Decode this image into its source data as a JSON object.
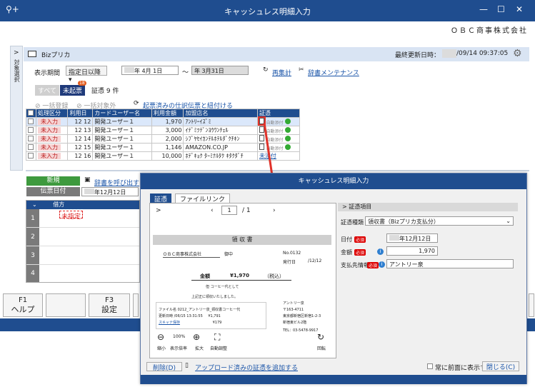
{
  "window": {
    "title": "キャッシュレス明細入力",
    "company": "ＯＢＣ商事株式会社"
  },
  "sidetab": {
    "label": "対象選択"
  },
  "header": {
    "app_name": "Bizプリカ",
    "last_updated_label": "最終更新日時：",
    "last_updated_value": "/09/14 09:37:05"
  },
  "filter": {
    "period_label": "表示期間",
    "period_mode": "指定日以降",
    "from_date": "年  4月  1日",
    "to_date": "年  3月31日",
    "refresh": "再集計",
    "maint": "辞書メンテナンス"
  },
  "tabs": {
    "all": "すべて",
    "unposted": "未起票",
    "unposted_badge": "18",
    "count": "証憑 9 件"
  },
  "actions": {
    "bulk_register": "一括登録",
    "bulk_exclude": "一括対象外",
    "link": "起票済みの仕訳伝票と紐付ける"
  },
  "table": {
    "headers": [
      "",
      "処理区分",
      "利用日",
      "カードユーザー名",
      "利用金額",
      "加盟店名",
      "証憑"
    ],
    "rows": [
      {
        "status": "未入力",
        "m": "12",
        "d": "12",
        "user": "開発ユーザー１",
        "amount": "1,970",
        "shop": "ｱﾝﾄﾘｰｲｽﾞﾐ",
        "attach": "自動添付"
      },
      {
        "status": "未入力",
        "m": "12",
        "d": "13",
        "user": "開発ユーザー１",
        "amount": "3,000",
        "shop": "ｲﾃﾞﾐﾂﾃﾞﾝﾖｳﾜﾝﾁｪﾙ",
        "attach": "自動添付"
      },
      {
        "status": "未入力",
        "m": "12",
        "d": "14",
        "user": "開発ユーザー１",
        "amount": "2,000",
        "shop": "ｼﾌﾞﾔｾｲｶﾝﾃﾙﾎﾃﾙﾀﾞｸﾁｷﾝ",
        "attach": "自動添付"
      },
      {
        "status": "未入力",
        "m": "12",
        "d": "15",
        "user": "開発ユーザー１",
        "amount": "1,146",
        "shop": "AMAZON.CO.JP",
        "attach": "自動添付"
      },
      {
        "status": "未入力",
        "m": "12",
        "d": "16",
        "user": "開発ユーザー１",
        "amount": "10,000",
        "shop": "ﾎﾃﾞｷｮｸ ﾀｰﾐﾅﾙﾀｸ ｷﾀｸﾀﾞﾁ",
        "attach": "未添付"
      }
    ]
  },
  "entry": {
    "new": "新規",
    "dict_call": "辞書を呼び出す",
    "voucher_date": "伝票日付",
    "voucher_date_value": "年12月12日",
    "credit": "借方",
    "unspecified": "未指定",
    "rows": [
      "1",
      "2",
      "3",
      "4"
    ]
  },
  "fkeys": [
    {
      "k": "F1",
      "label": "ヘルプ"
    },
    {
      "k": "",
      "label": ""
    },
    {
      "k": "F3",
      "label": "設定"
    }
  ],
  "dialog": {
    "title": "キャッシュレス明細入力",
    "tabs": [
      "証憑",
      "ファイルリンク"
    ],
    "page": "1",
    "page_total": "/ 1",
    "receipt": {
      "heading": "領 収 書",
      "company": "ＯＢＣ商事株式会社",
      "suffix": "御中",
      "no": "No.0132",
      "date": "発行日",
      "date_val": "/12/12",
      "amount_label": "金額",
      "amount": "¥1,970",
      "tax": "（税込）",
      "memo": "但  コーヒー代として",
      "received": "上記正に領収いたしました。",
      "issuer": "アントリー泉",
      "zip": "〒163-4711",
      "addr1": "東京都新宿区新宿1-2-3",
      "addr2": "新宿東ビル2階",
      "tel": "TEL：03-5478-9917",
      "file_label": "ファイル名",
      "file": "0212_アントリー泉_領収書コーヒー代",
      "upd_label": "更新日時",
      "upd": "/06/15 13:31:55",
      "scan_label": "スキャナ保存",
      "amt1": "¥1,791",
      "amt2": "¥179"
    },
    "zoom": "100%",
    "zoom_out": "縮小",
    "zoom_ratio": "表示倍率",
    "zoom_in": "拡大",
    "auto": "自動調整",
    "rotate": "回転",
    "right": {
      "section": "証憑項目",
      "type_label": "証憑種類",
      "type_value": "領収書（Bizプリカ支払分）",
      "date_label": "日付",
      "date_value": "年12月12日",
      "amount_label": "金額",
      "amount_value": "1,970",
      "payee_label": "支払先情報",
      "payee_value": "アントリー泉",
      "req": "必須"
    },
    "footer": {
      "delete": "削除(D)",
      "add": "アップロード済みの証憑を追加する",
      "front": "常に前面に表示する",
      "close": "閉じる(C)"
    }
  },
  "colors": {
    "titlebar": "#1f4d8f",
    "accent": "#1a54a8",
    "arrow": "#e0322a"
  }
}
